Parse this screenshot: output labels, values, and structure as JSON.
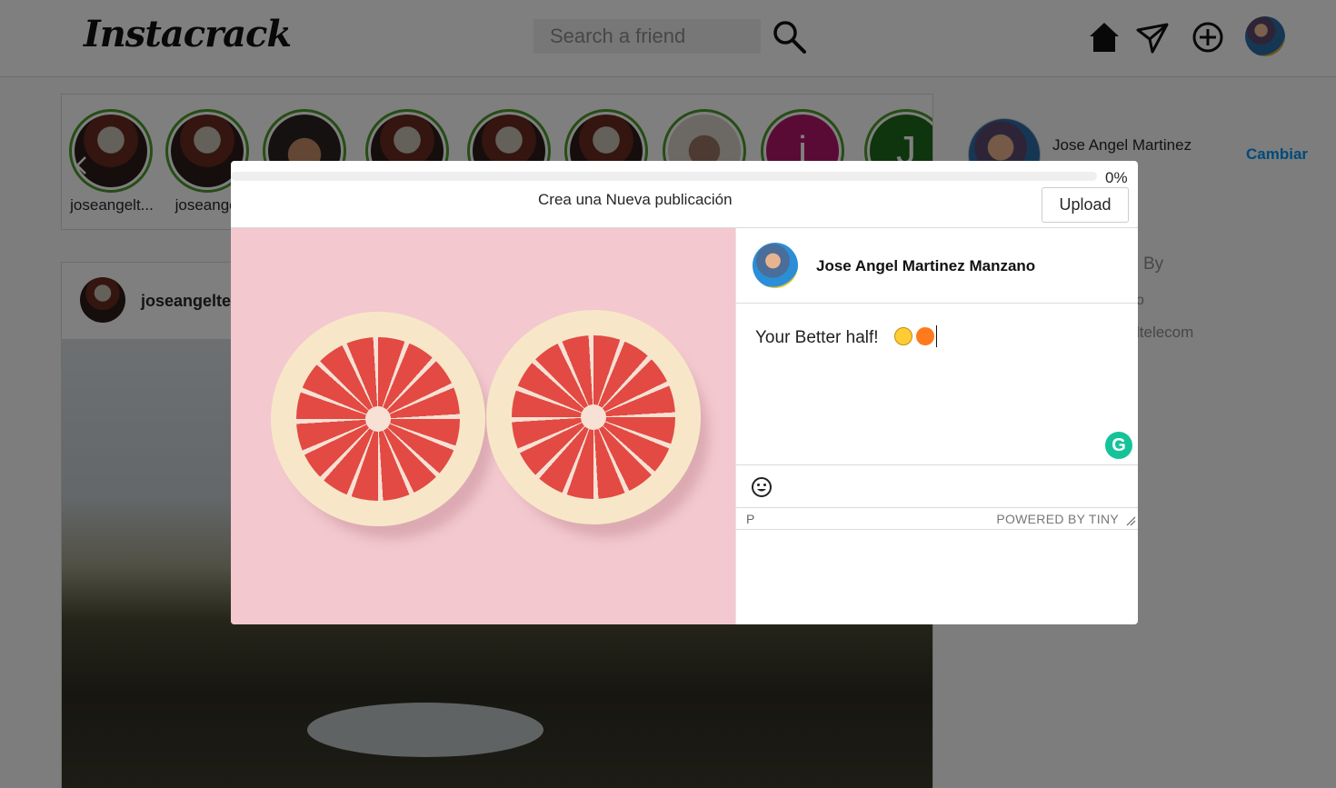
{
  "app": {
    "logo": "Instacrack"
  },
  "search": {
    "placeholder": "Search a friend"
  },
  "nav": {
    "icons": [
      "home-icon",
      "send-icon",
      "add-post-icon",
      "profile-avatar"
    ]
  },
  "stories": [
    {
      "name": "joseangelt..."
    },
    {
      "name": "joseangel"
    }
  ],
  "stories_visible_letters": [
    "i",
    "J"
  ],
  "post": {
    "username": "joseangeltel"
  },
  "sidebar": {
    "name": "Jose Angel Martinez",
    "name_cut": "M",
    "change_label": "Cambiar",
    "by_label": "By",
    "partial_1": "o",
    "partial_2": "ltelecom"
  },
  "modal": {
    "progress": {
      "value": 0,
      "label": "0%"
    },
    "title": "Crea una Nueva publicación",
    "upload_label": "Upload",
    "author": "Jose Angel Martinez Manzano",
    "caption": "Your Better half!",
    "caption_emojis": [
      "star-struck-emoji",
      "tangerine-emoji"
    ],
    "editor_path": "P",
    "powered_by": "POWERED BY TINY"
  },
  "colors": {
    "accent": "#0095f6",
    "story_ring": "#4c9a2a",
    "grammarly": "#15c39a"
  }
}
